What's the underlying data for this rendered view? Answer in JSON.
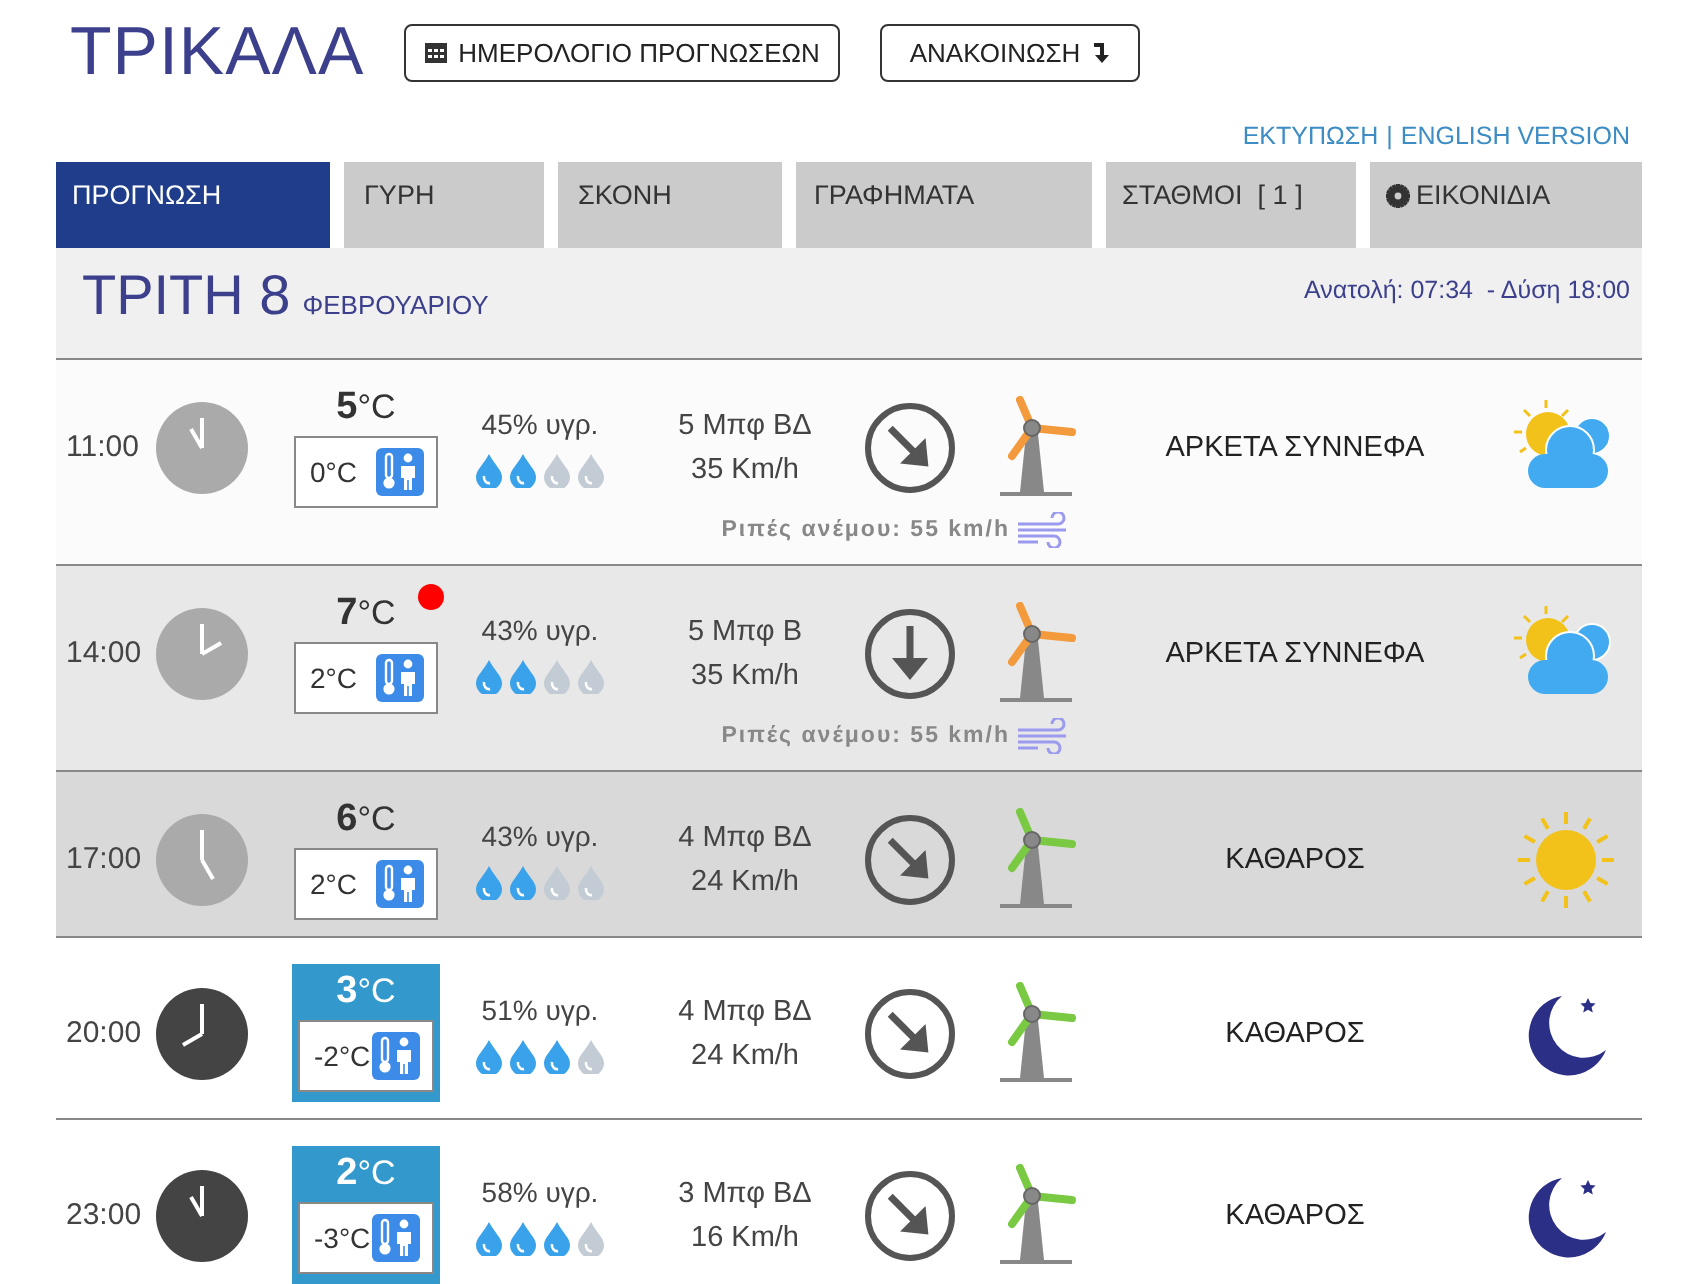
{
  "city": "ΤΡΙΚΑΛΑ",
  "buttons": [
    {
      "label": "ΗΜΕΡΟΛΟΓΙΟ ΠΡΟΓΝΩΣΕΩΝ",
      "kind": "calendar"
    },
    {
      "label": "ΑΝΑΚΟΙΝΩΣΗ",
      "kind": "download"
    }
  ],
  "links": [
    "ΕΚΤΥΠΩΣΗ",
    "ENGLISH VERSION"
  ],
  "link_separator": "|",
  "tabs": [
    {
      "label": "ΠΡΟΓΝΩΣΗ",
      "selected": true
    },
    {
      "label": "ΓΥΡΗ",
      "selected": false
    },
    {
      "label": "ΣΚΟΝΗ",
      "selected": false
    },
    {
      "label": "ΓΡΑΦΗΜΑΤΑ",
      "selected": false
    },
    {
      "label": "ΣΤΑΘΜΟΙ  [ 1 ]",
      "selected": false
    },
    {
      "label": "ΕΙΚΟΝΙΔΙΑ",
      "selected": false,
      "kind": "gear"
    }
  ],
  "day": {
    "weekday": "ΤΡΙΤΗ 8",
    "month": "ΦΕΒΡΟΥΑΡΙΟΥ",
    "sun": "Ανατολή: 07:34  - Δύση 18:00"
  },
  "rows": [
    {
      "time": "11:00",
      "color": "#fbfbfb",
      "night": false,
      "temp": "**5**°C",
      "feels": "0°C",
      "cold": false,
      "alert": false,
      "humidity": "45% υγρ.",
      "drops": [
        {
          "filled": true
        },
        {
          "filled": true
        },
        {
          "filled": false
        },
        {
          "filled": false
        }
      ],
      "wind": "5 Μπφ ΒΔ",
      "speed": "35 Km/h",
      "direction": {
        "kind": "down-right"
      },
      "turbine": {
        "color": "#f39a3c"
      },
      "gusts": "Ριπές ανέμου: 55 km/h",
      "condition": "ΑΡΚΕΤΑ ΣΥΝΝΕΦΑ",
      "weather": {
        "kind": "sun-cloud"
      }
    },
    {
      "time": "14:00",
      "color": "#e8e8e8",
      "night": false,
      "temp": "**7**°C",
      "feels": "2°C",
      "cold": false,
      "alert": true,
      "humidity": "43% υγρ.",
      "drops": [
        {
          "filled": true
        },
        {
          "filled": true
        },
        {
          "filled": false
        },
        {
          "filled": false
        }
      ],
      "wind": "5 Μπφ Β",
      "speed": "35 Km/h",
      "direction": {
        "kind": "down"
      },
      "turbine": {
        "color": "#f39a3c"
      },
      "gusts": "Ριπές ανέμου: 55 km/h",
      "condition": "ΑΡΚΕΤΑ ΣΥΝΝΕΦΑ",
      "weather": {
        "kind": "sun-cloud"
      }
    },
    {
      "time": "17:00",
      "color": "#d9d9d9",
      "night": false,
      "temp": "**6**°C",
      "feels": "2°C",
      "cold": false,
      "alert": false,
      "humidity": "43% υγρ.",
      "drops": [
        {
          "filled": true
        },
        {
          "filled": true
        },
        {
          "filled": false
        },
        {
          "filled": false
        }
      ],
      "wind": "4 Μπφ ΒΔ",
      "speed": "24 Km/h",
      "direction": {
        "kind": "down-right"
      },
      "turbine": {
        "color": "#7ac943"
      },
      "condition": "ΚΑΘΑΡΟΣ",
      "weather": {
        "kind": "sun"
      }
    },
    {
      "time": "20:00",
      "color": "#ffffff",
      "night": true,
      "temp": "**3**°C",
      "feels": "-2°C",
      "cold": true,
      "alert": false,
      "humidity": "51% υγρ.",
      "drops": [
        {
          "filled": true
        },
        {
          "filled": true
        },
        {
          "filled": true
        },
        {
          "filled": false
        }
      ],
      "wind": "4 Μπφ ΒΔ",
      "speed": "24 Km/h",
      "direction": {
        "kind": "down-right"
      },
      "turbine": {
        "color": "#7ac943"
      },
      "condition": "ΚΑΘΑΡΟΣ",
      "weather": {
        "kind": "moon"
      }
    },
    {
      "time": "23:00",
      "color": "#ffffff",
      "night": true,
      "temp": "**2**°C",
      "feels": "-3°C",
      "cold": true,
      "alert": false,
      "humidity": "58% υγρ.",
      "drops": [
        {
          "filled": true
        },
        {
          "filled": true
        },
        {
          "filled": true
        },
        {
          "filled": false
        }
      ],
      "wind": "3 Μπφ ΒΔ",
      "speed": "16 Km/h",
      "direction": {
        "kind": "down-right"
      },
      "turbine": {
        "color": "#7ac943"
      },
      "condition": "ΚΑΘΑΡΟΣ",
      "weather": {
        "kind": "moon"
      }
    }
  ]
}
